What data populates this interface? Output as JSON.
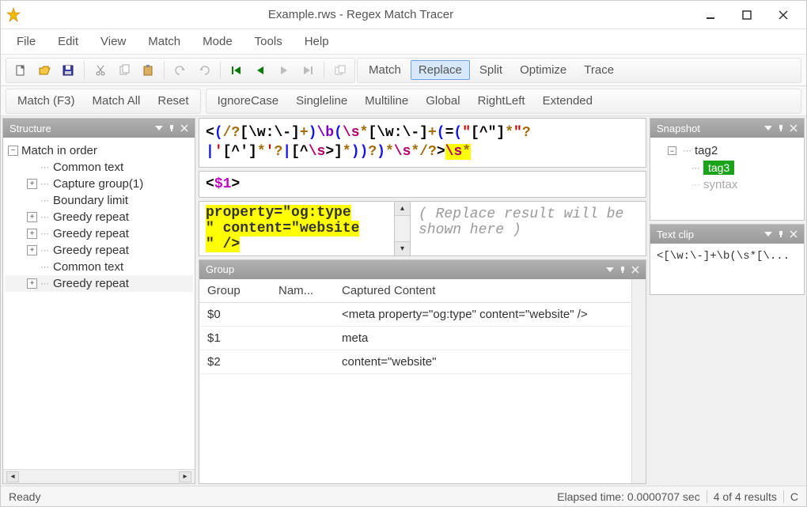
{
  "window": {
    "title": "Example.rws - Regex Match Tracer"
  },
  "menu": [
    "File",
    "Edit",
    "View",
    "Match",
    "Mode",
    "Tools",
    "Help"
  ],
  "toolbar_tabs": [
    "Match",
    "Replace",
    "Split",
    "Optimize",
    "Trace"
  ],
  "toolbar_active_tab": "Replace",
  "toolbar2": {
    "match_f3": "Match (F3)",
    "match_all": "Match All",
    "reset": "Reset",
    "ignore_case": "IgnoreCase",
    "singleline": "Singleline",
    "multiline": "Multiline",
    "global": "Global",
    "rightleft": "RightLeft",
    "extended": "Extended"
  },
  "panels": {
    "structure": "Structure",
    "snapshot": "Snapshot",
    "textclip": "Text clip",
    "group": "Group"
  },
  "structure_tree": {
    "root": "Match in order",
    "items": [
      "Common text",
      "Capture group(1)",
      "Boundary limit",
      "Greedy repeat",
      "Greedy repeat",
      "Greedy repeat",
      "Common text",
      "Greedy repeat"
    ]
  },
  "regex": {
    "line1_parts": [
      {
        "t": "<",
        "c": "c-black"
      },
      {
        "t": "(",
        "c": "c-blue"
      },
      {
        "t": "/?",
        "c": "c-brown"
      },
      {
        "t": "[\\w:\\-]",
        "c": "c-black"
      },
      {
        "t": "+",
        "c": "c-brown"
      },
      {
        "t": ")",
        "c": "c-blue"
      },
      {
        "t": "\\b",
        "c": "c-purple"
      },
      {
        "t": "(",
        "c": "c-blue"
      },
      {
        "t": "\\s",
        "c": "c-pink"
      },
      {
        "t": "*",
        "c": "c-brown"
      },
      {
        "t": "[\\w:\\-]",
        "c": "c-black"
      },
      {
        "t": "+",
        "c": "c-brown"
      },
      {
        "t": "(",
        "c": "c-blue"
      },
      {
        "t": "=",
        "c": "c-black"
      },
      {
        "t": "(",
        "c": "c-blue"
      },
      {
        "t": "\"",
        "c": "c-red"
      },
      {
        "t": "[^\"]",
        "c": "c-black"
      },
      {
        "t": "*",
        "c": "c-brown"
      },
      {
        "t": "\"",
        "c": "c-red"
      },
      {
        "t": "?",
        "c": "c-brown"
      }
    ],
    "line2_parts": [
      {
        "t": "|",
        "c": "c-blue"
      },
      {
        "t": "'",
        "c": "c-red"
      },
      {
        "t": "[^']",
        "c": "c-black"
      },
      {
        "t": "*",
        "c": "c-brown"
      },
      {
        "t": "'",
        "c": "c-red"
      },
      {
        "t": "?",
        "c": "c-brown"
      },
      {
        "t": "|",
        "c": "c-blue"
      },
      {
        "t": "[^",
        "c": "c-black"
      },
      {
        "t": "\\s",
        "c": "c-pink"
      },
      {
        "t": ">]",
        "c": "c-black"
      },
      {
        "t": "*",
        "c": "c-brown"
      },
      {
        "t": ")",
        "c": "c-blue"
      },
      {
        "t": ")",
        "c": "c-blue"
      },
      {
        "t": "?",
        "c": "c-brown"
      },
      {
        "t": ")",
        "c": "c-blue"
      },
      {
        "t": "*",
        "c": "c-brown"
      },
      {
        "t": "\\s",
        "c": "c-pink"
      },
      {
        "t": "*",
        "c": "c-brown"
      },
      {
        "t": "/?",
        "c": "c-brown"
      },
      {
        "t": ">",
        "c": "c-black"
      },
      {
        "t": "\\s",
        "c": "c-pink",
        "bg": true
      },
      {
        "t": "*",
        "c": "c-brown",
        "bg": true
      }
    ]
  },
  "replacement_pattern": {
    "lt": "<",
    "var": "$1",
    "gt": ">"
  },
  "sample_match": {
    "l1": "property=\"og:type",
    "l2": "\" content=\"website",
    "l3": "\" />"
  },
  "replace_result_placeholder": "( Replace result will be shown here )",
  "group_table": {
    "headers": [
      "Group",
      "Nam...",
      "Captured Content"
    ],
    "rows": [
      {
        "g": "$0",
        "n": "",
        "c": "<meta property=\"og:type\" content=\"website\" />"
      },
      {
        "g": "$1",
        "n": "",
        "c": "meta"
      },
      {
        "g": "$2",
        "n": "",
        "c": " content=\"website\""
      }
    ]
  },
  "snapshot": {
    "items": [
      "tag2",
      "tag3",
      "syntax"
    ]
  },
  "textclip": "<[\\w:\\-]+\\b(\\s*[\\...",
  "status": {
    "ready": "Ready",
    "elapsed": "Elapsed time: 0.0000707 sec",
    "results": "4 of 4 results",
    "extra": "C"
  }
}
